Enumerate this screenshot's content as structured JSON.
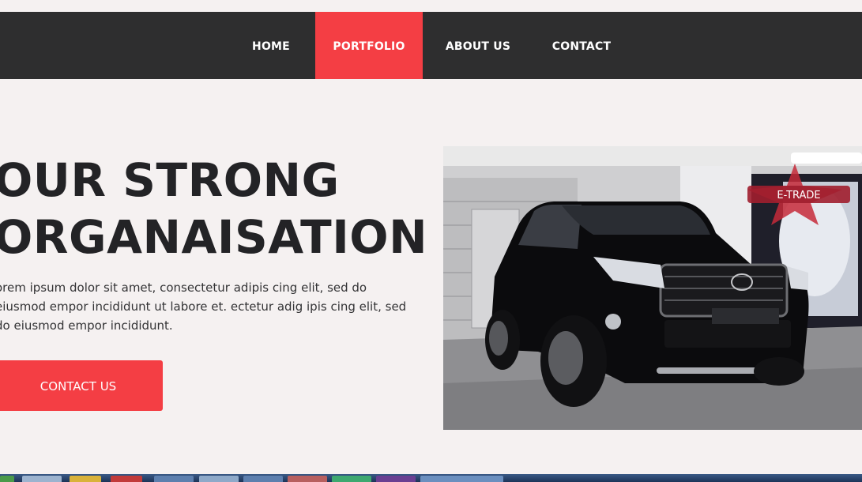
{
  "nav": {
    "items": [
      {
        "label": "HOME",
        "active": false
      },
      {
        "label": "PORTFOLIO",
        "active": true
      },
      {
        "label": "ABOUT US",
        "active": false
      },
      {
        "label": "CONTACT",
        "active": false
      }
    ]
  },
  "hero": {
    "title_line1": "OUR STRONG",
    "title_line2": "ORGANAISATION",
    "body": "orem ipsum dolor sit amet, consectetur adipis cing elit, sed do eiusmod empor incididunt ut labore et. ectetur adig ipis cing elit, sed do eiusmod empor incididunt.",
    "button_label": "CONTACT US"
  },
  "photo": {
    "subject": "black SUV in garage",
    "logo_text": "E-TRADE"
  },
  "colors": {
    "accent": "#f43e44",
    "nav_bg": "#2e2e2f",
    "page_bg": "#f5f1f1",
    "heading": "#232326"
  },
  "taskbar": {
    "icons": [
      "start-orb-icon",
      "folder-icon",
      "chrome-icon",
      "media-icon",
      "app-icon",
      "window-icon",
      "browser-icon",
      "network-icon",
      "editor-icon",
      "explorer-icon",
      "skype-icon"
    ]
  }
}
